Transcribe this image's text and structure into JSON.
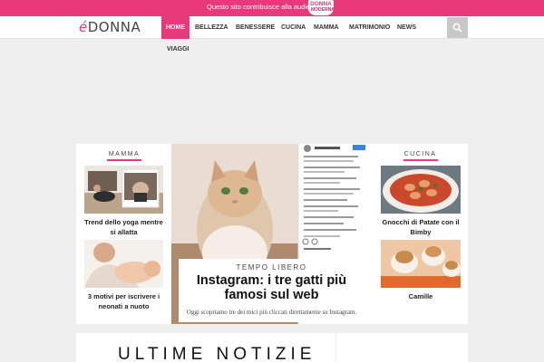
{
  "topbar": {
    "text": "Questo sito contribuisce alla audience di",
    "logo_line1": "DONNA",
    "logo_line2": "MODERNA"
  },
  "header": {
    "logo_e": "é",
    "logo_donna": "DONNA"
  },
  "nav": {
    "home": "HOME",
    "bellezza": "BELLEZZA",
    "benessere": "BENESSERE",
    "cucina": "CUCINA",
    "mamma": "MAMMA",
    "matrimonio": "MATRIMONIO",
    "news": "NEWS",
    "viaggi": "VIAGGI"
  },
  "left_column": {
    "label": "MAMMA",
    "items": [
      {
        "caption": "Trend dello yoga mentre si allatta"
      },
      {
        "caption": "3 motivi per iscrivere i neonati a nuoto"
      }
    ]
  },
  "right_column": {
    "label": "CUCINA",
    "items": [
      {
        "caption": "Gnocchi di Patate con il Bimby"
      },
      {
        "caption": "Camille"
      }
    ]
  },
  "feature": {
    "category": "TEMPO LIBERO",
    "title": "Instagram: i tre gatti più famosi sul web",
    "text": "Oggi scopriamo tre dei mici più cliccati direttamente su Instagram."
  },
  "latest": {
    "title": "ULTIME NOTIZIE"
  },
  "colors": {
    "accent": "#e8397a",
    "background": "#efefef"
  },
  "icons": [
    "search-icon"
  ]
}
